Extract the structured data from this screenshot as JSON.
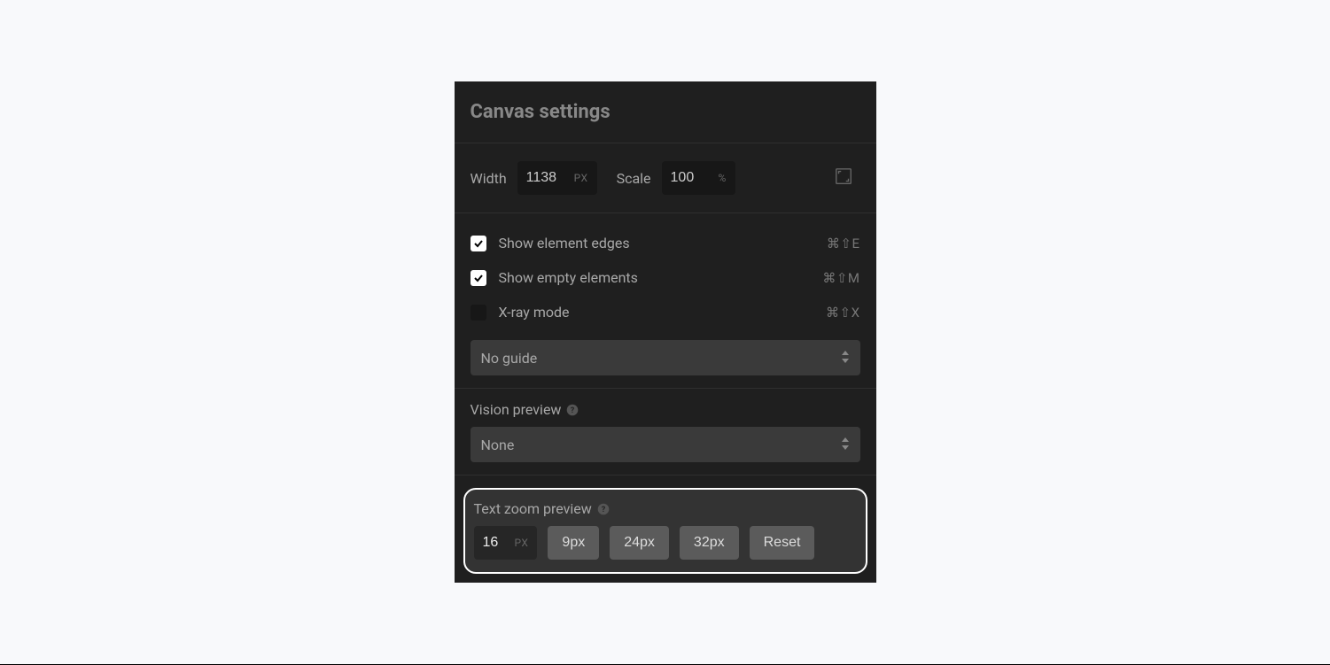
{
  "title": "Canvas settings",
  "sizeRow": {
    "widthLabel": "Width",
    "widthValue": "1138",
    "widthUnit": "PX",
    "scaleLabel": "Scale",
    "scaleValue": "100",
    "scaleUnit": "%"
  },
  "toggles": {
    "edges": {
      "label": "Show element edges",
      "shortcut": "⌘⇧E",
      "checked": true
    },
    "empty": {
      "label": "Show empty elements",
      "shortcut": "⌘⇧M",
      "checked": true
    },
    "xray": {
      "label": "X-ray mode",
      "shortcut": "⌘⇧X",
      "checked": false
    }
  },
  "guideSelect": "No guide",
  "visionLabel": "Vision preview",
  "visionSelect": "None",
  "textZoom": {
    "label": "Text zoom preview",
    "value": "16",
    "unit": "PX",
    "presets": [
      "9px",
      "24px",
      "32px"
    ],
    "reset": "Reset"
  }
}
